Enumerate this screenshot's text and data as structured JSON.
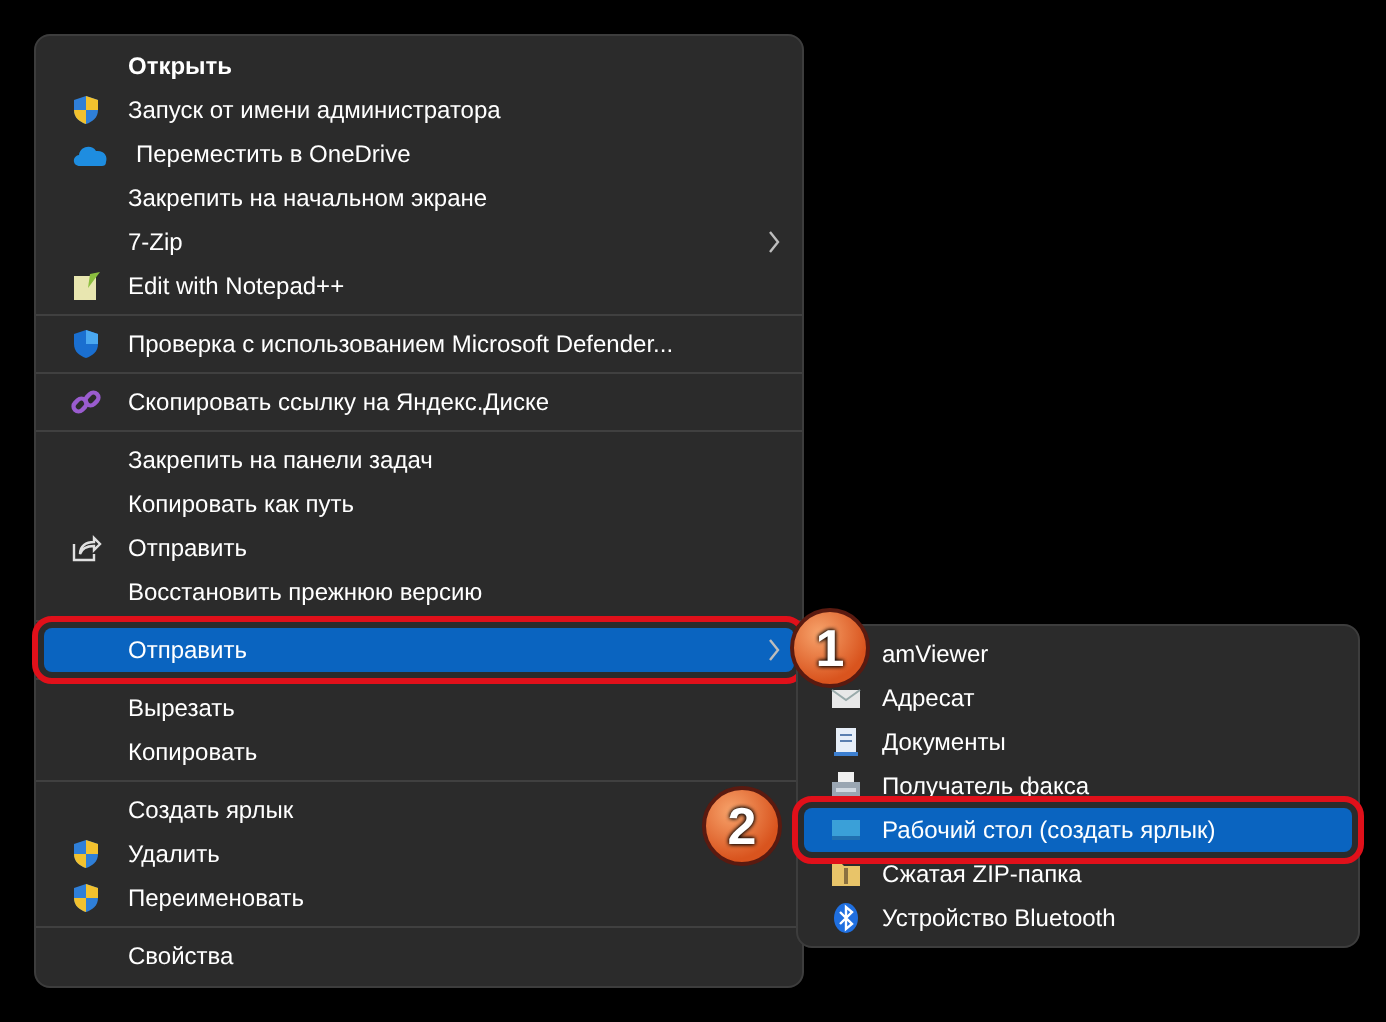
{
  "context_menu": {
    "groups": [
      {
        "items": [
          {
            "label": "Открыть",
            "submenu": false,
            "selected": false
          },
          {
            "label": "Запуск от имени администратора",
            "submenu": false,
            "selected": false
          },
          {
            "label": "Переместить в OneDrive",
            "submenu": false,
            "selected": false
          },
          {
            "label": "Закрепить на начальном экране",
            "submenu": false,
            "selected": false
          },
          {
            "label": "7-Zip",
            "submenu": true,
            "selected": false
          },
          {
            "label": "Edit with Notepad++",
            "submenu": false,
            "selected": false
          }
        ]
      },
      {
        "items": [
          {
            "label": "Проверка с использованием Microsoft Defender...",
            "submenu": false,
            "selected": false
          }
        ]
      },
      {
        "items": [
          {
            "label": "Скопировать ссылку на Яндекс.Диске",
            "submenu": false,
            "selected": false
          }
        ]
      },
      {
        "items": [
          {
            "label": "Закрепить на панели задач",
            "submenu": false,
            "selected": false
          },
          {
            "label": "Копировать как путь",
            "submenu": false,
            "selected": false
          },
          {
            "label": "Отправить",
            "submenu": false,
            "selected": false
          },
          {
            "label": "Восстановить прежнюю версию",
            "submenu": false,
            "selected": false
          }
        ]
      },
      {
        "items": [
          {
            "label": "Отправить",
            "submenu": true,
            "selected": true
          }
        ]
      },
      {
        "items": [
          {
            "label": "Вырезать",
            "submenu": false,
            "selected": false
          },
          {
            "label": "Копировать",
            "submenu": false,
            "selected": false
          }
        ]
      },
      {
        "items": [
          {
            "label": "Создать ярлык",
            "submenu": false,
            "selected": false
          },
          {
            "label": "Удалить",
            "submenu": false,
            "selected": false
          },
          {
            "label": "Переименовать",
            "submenu": false,
            "selected": false
          }
        ]
      },
      {
        "items": [
          {
            "label": "Свойства",
            "submenu": false,
            "selected": false
          }
        ]
      }
    ]
  },
  "send_to_submenu": {
    "items": [
      {
        "label": "amViewer",
        "selected": false
      },
      {
        "label": "Адресат",
        "selected": false
      },
      {
        "label": "Документы",
        "selected": false
      },
      {
        "label": "Получатель факса",
        "selected": false
      },
      {
        "label": "Рабочий стол (создать ярлык)",
        "selected": true
      },
      {
        "label": "Сжатая ZIP-папка",
        "selected": false
      },
      {
        "label": "Устройство Bluetooth",
        "selected": false
      }
    ]
  },
  "callouts": [
    {
      "label": "1"
    },
    {
      "label": "2"
    }
  ]
}
